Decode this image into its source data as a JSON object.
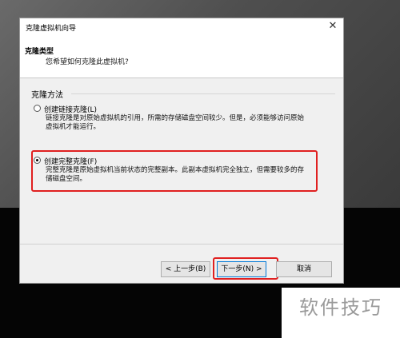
{
  "window": {
    "title": "克隆虚拟机向导",
    "close_glyph": "✕"
  },
  "header": {
    "title": "克隆类型",
    "subtitle": "您希望如何克隆此虚拟机?"
  },
  "clone_method": {
    "group_label": "克隆方法",
    "options": [
      {
        "label": "创建链接克隆(L)",
        "description": "链接克隆是对原始虚拟机的引用，所需的存储磁盘空间较少。但是，必须能够访问原始虚拟机才能运行。",
        "selected": false
      },
      {
        "label": "创建完整克隆(F)",
        "description": "完整克隆是原始虚拟机当前状态的完整副本。此副本虚拟机完全独立，但需要较多的存储磁盘空间。",
        "selected": true
      }
    ]
  },
  "buttons": {
    "back": "< 上一步(B)",
    "next": "下一步(N) >",
    "cancel": "取消"
  },
  "highlight_color": "#e02020",
  "watermark": "软件技巧"
}
